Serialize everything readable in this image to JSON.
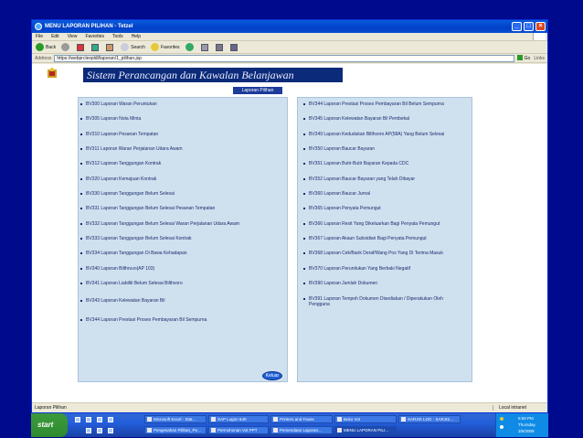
{
  "window": {
    "title": "MENU LAPORAN PILIHAN - Tetzel"
  },
  "menubar": [
    "File",
    "Edit",
    "View",
    "Favorites",
    "Tools",
    "Help"
  ],
  "toolbar": {
    "back": "Back",
    "search": "Search",
    "favorites": "Favorites"
  },
  "address": {
    "label": "Address",
    "url": "https://webprclexpldl/laporan/1_pilihan.jsp",
    "go": "Go",
    "links": "Links"
  },
  "page": {
    "banner": "Sistem Perancangan dan Kawalan Belanjawan",
    "subtitle": "Laporan Pilihan",
    "left_items": [
      "BV300 Laporan Waran Peruntukan",
      "BV305 Laporan Nota Minta",
      "BV310 Laporan Pesanan Tempatan",
      "BV311 Laporan Waran Perjalanan Udara Awam",
      "BV312 Laporan Tanggungan Kontrak",
      "BV320 Laporan Kemajuan Kontrak",
      "BV330 Laporan Tanggungan Belum Selesai",
      "BV331 Laporan Tanggungan Belum Selesai Pesanan Tempatan",
      "BV332 Laporan Tanggungan Belum Selesai Waran Perjalanan Udara Awam",
      "BV333 Laporan Tanggungan Belum Selesai Kontrak",
      "BV334 Laporan Tanggungan Di Bawa Kehadapan",
      "BV340 Laporan Bilthruvo(AP 103)",
      "BV341 Laporan Liabiliti Belum Selesai Bilthvoro",
      "BV343 Laporan Kelewatan Bayaran Bil",
      "BV344 Laporan Prestasi Proses Pembayaran Bil Sempurna"
    ],
    "right_items": [
      "BV344 Laporan Prestasi Proses Pembayaran Bil Belum Sempurna",
      "BV345 Laporan Kelewatan Bayaran Bil Pembekal",
      "BV349 Laporan Kedudukan Bilthvoro AP(58A) Yang Belum Selesai",
      "BV350 Laporan Baucar Bayaran",
      "BV351 Laporan Butir-Butir Bayaran Kepada CDC",
      "BV352 Laporan Baucar Bayaran yang Telah Dibayar",
      "BV360 Laporan Baucar Jurnal",
      "BV365 Laporan Penyata Pemungut",
      "BV366 Laporan Resit Yang Dikeluarkan Bagi Penyata Pemungut",
      "BV367 Laporan Akaun Subsidiari Bagi Penyata Pemungut",
      "BV368 Laporan Cek/Bank Deraf/Wang Pos Yang Di Terima Masuk",
      "BV370 Laporan Perunitukan Yang Berbaki Negatif",
      "BV390 Laporan Jumlah Dokumen",
      "BV391 Laporan Tempoh Dokumen Disediakan / Diperakukan Oleh Pengguna"
    ],
    "logout": "Keluar"
  },
  "status": {
    "text": "Laporan Pilihan",
    "zone": "Local intranet"
  },
  "taskbar": {
    "start": "start",
    "tasks": [
      "Microsoft Excel - Stat...",
      "SAP Logon 640",
      "Printers and Faxes",
      "Buku Vot",
      "SARJIS LOG - SARJIS...",
      "Pengesahan Pilihan_Pe...",
      "Permohonan Vot PPT",
      "Persendaan Laporan...",
      "MENU LAPORAN PILI..."
    ],
    "clock": [
      "5:59 PM",
      "Thursday",
      "3/5/2009"
    ]
  },
  "colors": {
    "banner": "#0c2a7a",
    "panel": "#cfe0ef",
    "slide_bg": "#000a8c"
  }
}
